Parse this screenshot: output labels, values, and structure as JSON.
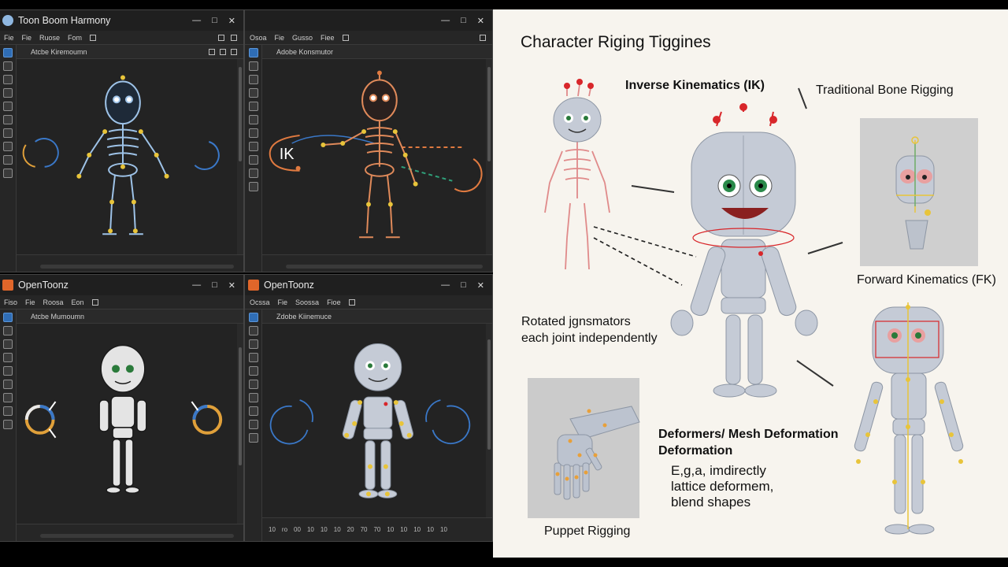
{
  "windows": [
    {
      "title": "Toon Boom Harmony",
      "menu": [
        "Fie",
        "Fie",
        "Ruose",
        "Fom"
      ],
      "viewport_label": "Atcbe Kiremoumn",
      "ik_label": "",
      "controls": [
        "—",
        "□",
        "✕"
      ]
    },
    {
      "title": "",
      "menu": [
        "Osoa",
        "Fie",
        "Gusso",
        "Fiee"
      ],
      "viewport_label": "Adobe Konsmutor",
      "ik_label": "IK",
      "controls": [
        "—",
        "□",
        "✕"
      ]
    },
    {
      "title": "OpenToonz",
      "menu": [
        "Fiso",
        "Fie",
        "Roosa",
        "Eon"
      ],
      "viewport_label": "Atcbe Mumoumn",
      "ik_label": "",
      "controls": [
        "—",
        "□",
        "✕"
      ]
    },
    {
      "title": "OpenToonz",
      "menu": [
        "Ocssa",
        "Fie",
        "Soossa",
        "Fioe"
      ],
      "viewport_label": "Zdobe Kiinemuce",
      "ik_label": "",
      "controls": [
        "—",
        "□",
        "✕"
      ]
    }
  ],
  "timeline_ticks": [
    "10",
    "ro",
    "00",
    "10",
    "10",
    "10",
    "20",
    "70",
    "70",
    "10",
    "10",
    "10",
    "10",
    "10"
  ],
  "panel": {
    "title": "Character Riging Tiggines",
    "labels": {
      "ik": "Inverse Kinematics (IK)",
      "traditional": "Traditional Bone Rigging",
      "fk": "Forward Kinematics (FK)",
      "rotated": "Rotated jgnsmators",
      "rotated2": "each joint independently",
      "deformers": "Deformers/ Mesh Deformation",
      "deformers2": "Deformation",
      "example1": "E,g,a, imdirectly",
      "example2": "lattice deformem,",
      "example3": "blend shapes",
      "puppet": "Puppet Rigging"
    }
  },
  "colors": {
    "window_bg": "#2b2b2b",
    "bone_blue": "#9ec3e8",
    "bone_orange": "#e08a5a",
    "joint_yellow": "#e8c43a",
    "robot_body": "#c5cbd6",
    "panel_bg": "#f7f4ee",
    "ik_red": "#d8262a"
  },
  "icons": [
    "minimize-icon",
    "maximize-icon",
    "close-icon",
    "app-logo-icon",
    "rotate-arrow-icon",
    "ik-arrow-icon"
  ]
}
